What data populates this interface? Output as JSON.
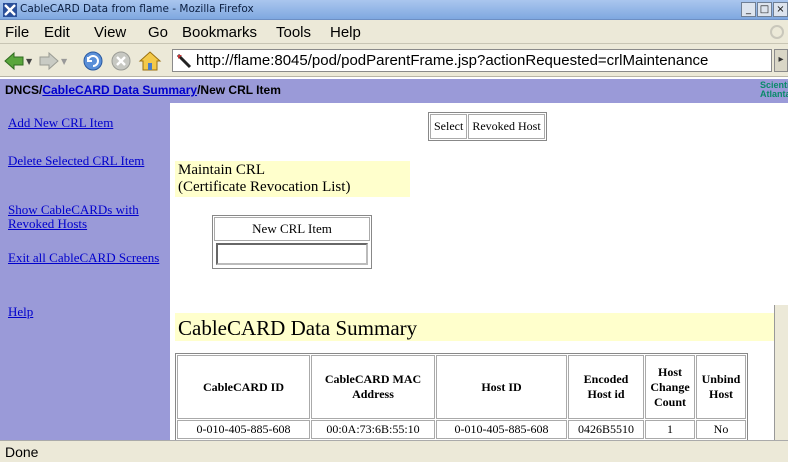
{
  "window": {
    "title": "CableCARD Data from flame - Mozilla Firefox",
    "buttons": [
      "_",
      "□",
      "×"
    ]
  },
  "menu": [
    "File",
    "Edit",
    "View",
    "Go",
    "Bookmarks",
    "Tools",
    "Help"
  ],
  "nav": {
    "url": "http://flame:8045/pod/podParentFrame.jsp?actionRequested=crlMaintenance",
    "icons": [
      "back-icon",
      "forward-icon",
      "reload-icon",
      "stop-icon",
      "home-icon"
    ]
  },
  "breadcrumb": {
    "root": "DNCS/",
    "link": "CableCARD Data Summary",
    "current": "/New CRL Item",
    "brand_line1": "Scientific",
    "brand_line2": "Atlanta"
  },
  "sidebar": {
    "items": [
      {
        "label": "Add New CRL Item"
      },
      {
        "label": "Delete Selected CRL Item"
      },
      {
        "label": "Show CableCARDs with Revoked Hosts"
      },
      {
        "label": "Exit all CableCARD Screens"
      },
      {
        "label": "Help"
      }
    ]
  },
  "content": {
    "actions": [
      "Select",
      "Revoked Host"
    ],
    "maintain_line1": "Maintain CRL",
    "maintain_line2": "(Certificate Revocation List)",
    "new_crl_label": "New CRL Item",
    "new_crl_value": "",
    "summary_title": "CableCARD Data Summary",
    "table": {
      "headers": [
        "CableCARD ID",
        "CableCARD MAC Address",
        "Host ID",
        "Encoded Host id",
        "Host Change Count",
        "Unbind Host"
      ],
      "rows": [
        [
          "0-010-405-885-608",
          "00:0A:73:6B:55:10",
          "0-010-405-885-608",
          "0426B5510",
          "1",
          "No"
        ]
      ]
    }
  },
  "status": "Done"
}
